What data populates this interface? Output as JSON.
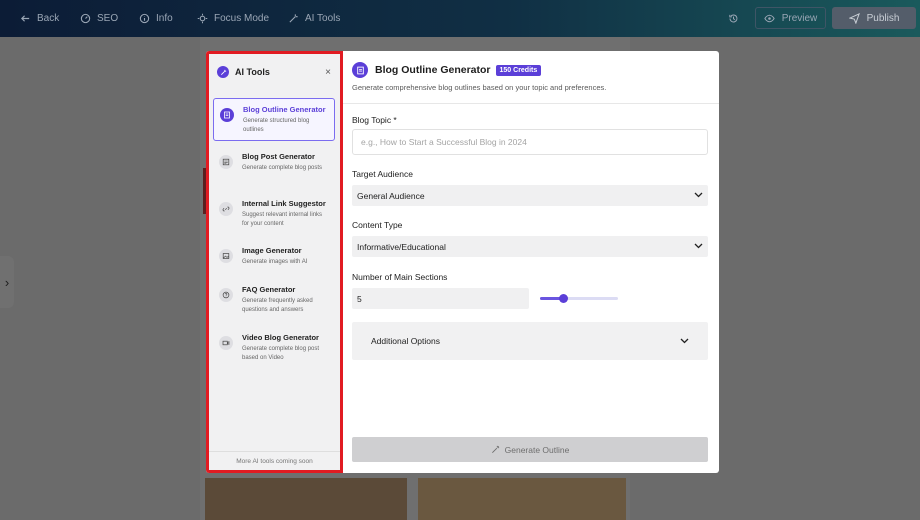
{
  "topbar": {
    "back": "Back",
    "seo": "SEO",
    "info": "Info",
    "focus": "Focus Mode",
    "ai_tools": "AI Tools",
    "preview": "Preview",
    "publish": "Publish"
  },
  "sidebar": {
    "title": "AI Tools",
    "close": "×",
    "tools": [
      {
        "name": "Blog Outline Generator",
        "desc": "Generate structured blog outlines",
        "icon": "document-icon"
      },
      {
        "name": "Blog Post Generator",
        "desc": "Generate complete blog posts",
        "icon": "article-icon"
      },
      {
        "name": "Internal Link Suggestor",
        "desc": "Suggest relevant internal links for your content",
        "icon": "link-icon"
      },
      {
        "name": "Image Generator",
        "desc": "Generate images with AI",
        "icon": "image-icon"
      },
      {
        "name": "FAQ Generator",
        "desc": "Generate frequently asked questions and answers",
        "icon": "question-icon"
      },
      {
        "name": "Video Blog Generator",
        "desc": "Generate complete blog post based on Video",
        "icon": "video-icon"
      }
    ],
    "footer": "More AI tools coming soon"
  },
  "main": {
    "title": "Blog Outline Generator",
    "credits": "150 Credits",
    "subtitle": "Generate comprehensive blog outlines based on your topic and preferences.",
    "topic_label": "Blog Topic *",
    "topic_placeholder": "e.g., How to Start a Successful Blog in 2024",
    "audience_label": "Target Audience",
    "audience_value": "General Audience",
    "content_label": "Content Type",
    "content_value": "Informative/Educational",
    "sections_label": "Number of Main Sections",
    "sections_value": "5",
    "advanced": "Additional Options",
    "generate": "Generate Outline"
  },
  "colors": {
    "accent": "#5b3fd8",
    "highlight_border": "#e11b22"
  }
}
